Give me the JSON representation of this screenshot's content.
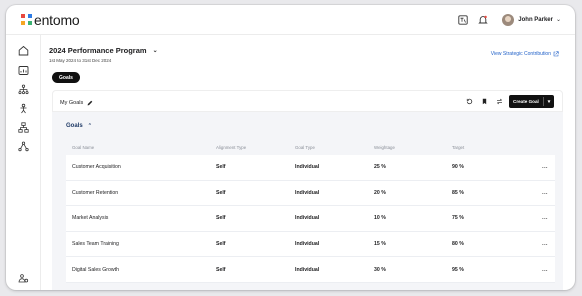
{
  "app": {
    "brand": "entomo",
    "brand_colors": [
      "#e8483f",
      "#f6a623",
      "#3bb273",
      "#2d7be5"
    ],
    "accent": "#2463c9"
  },
  "header": {
    "user_name": "John Parker",
    "icons": [
      "translate-icon",
      "notification-bell-icon",
      "avatar",
      "chevron-down-icon"
    ]
  },
  "sidebar": {
    "icons": [
      "home-icon",
      "chart-card-icon",
      "org-chart-icon",
      "performance-icon",
      "team-hierarchy-icon",
      "network-icon",
      "settings-people-icon"
    ]
  },
  "program": {
    "title": "2024 Performance Program",
    "dates": "1st May 2024 to 31st Dec 2024",
    "strategic_link": "View Strategic Contribution"
  },
  "tabs": {
    "active": "Goals"
  },
  "panel": {
    "title": "My Goals",
    "create_button": "Create Goal",
    "section_title": "Goals"
  },
  "table": {
    "columns": [
      "Goal Name",
      "Alignment Type",
      "Goal Type",
      "Weightage",
      "Target"
    ],
    "rows": [
      {
        "name": "Customer Acquisition",
        "alignment": "Self",
        "type": "Individual",
        "weight": "25 %",
        "target": "90 %",
        "more": "..."
      },
      {
        "name": "Customer Retention",
        "alignment": "Self",
        "type": "Individual",
        "weight": "20 %",
        "target": "85 %",
        "more": "..."
      },
      {
        "name": "Market Analysis",
        "alignment": "Self",
        "type": "Individual",
        "weight": "10 %",
        "target": "75 %",
        "more": "..."
      },
      {
        "name": "Sales Team Training",
        "alignment": "Self",
        "type": "Individual",
        "weight": "15 %",
        "target": "80 %",
        "more": "..."
      },
      {
        "name": "Digital Sales Growth",
        "alignment": "Self",
        "type": "Individual",
        "weight": "30 %",
        "target": "95 %",
        "more": "..."
      }
    ]
  }
}
